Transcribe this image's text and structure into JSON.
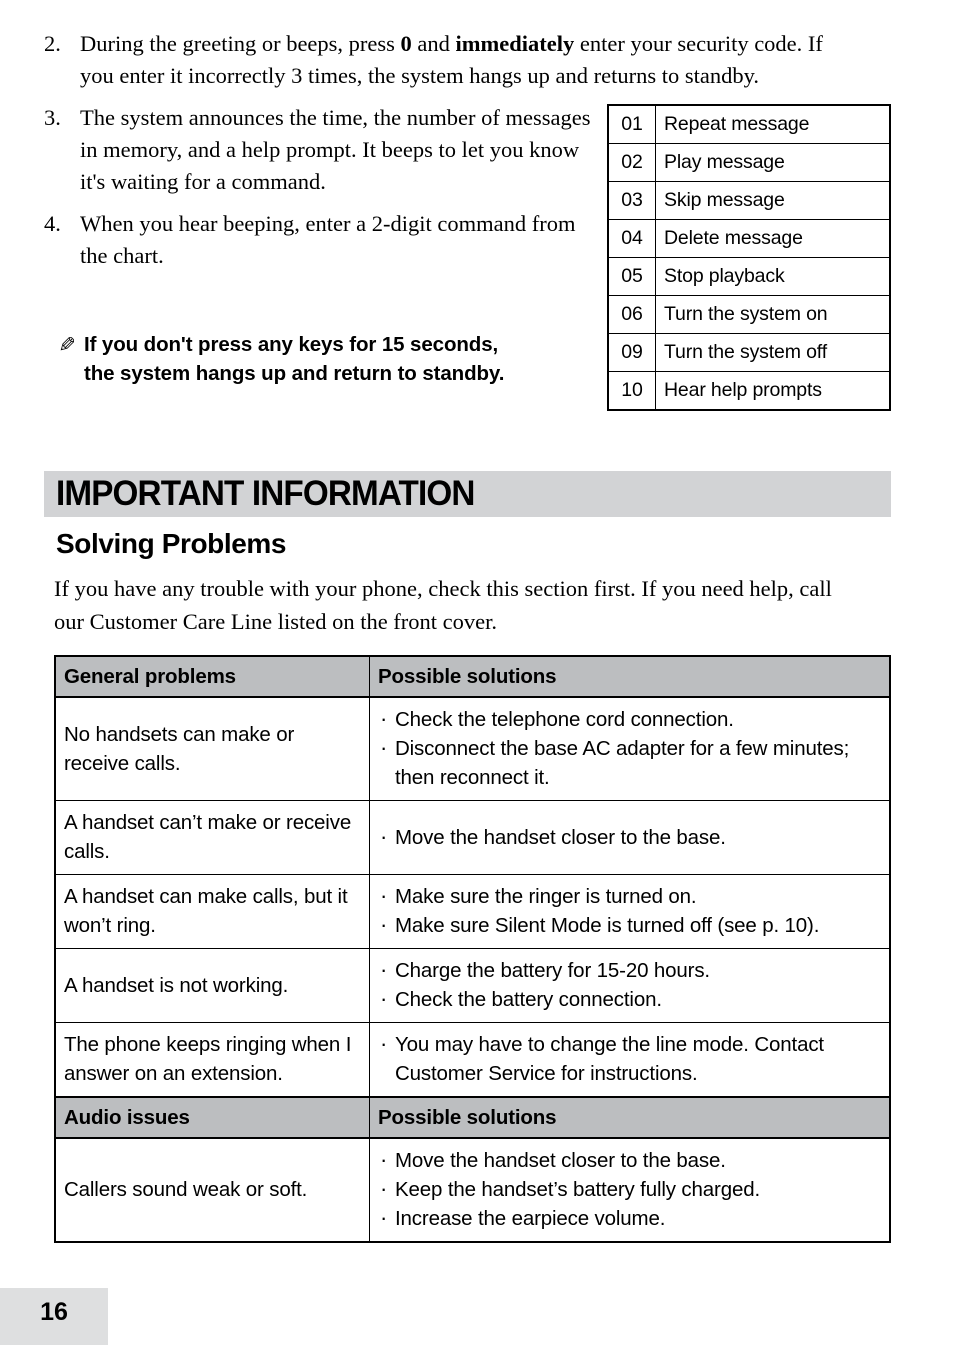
{
  "page": {
    "number": "16"
  },
  "steps": [
    {
      "num": "2.",
      "html": "During the greeting or beeps, press <b>0</b> and <b>immediately</b> enter your security code. If you enter it incorrectly 3 times, the system hangs up and returns to standby."
    },
    {
      "num": "3.",
      "html": "The system announces the time, the number of messages in memory, and a help prompt. It beeps to let you know it's waiting for a command."
    },
    {
      "num": "4.",
      "html": "When you hear beeping, enter a 2-digit command from the chart."
    }
  ],
  "note": {
    "icon": "pen-note-icon",
    "glyph": "✎",
    "text": "If you don't press any keys for 15 seconds, the system hangs up and return to standby."
  },
  "command_table": {
    "rows": [
      {
        "code": "01",
        "desc": "Repeat message"
      },
      {
        "code": "02",
        "desc": "Play message"
      },
      {
        "code": "03",
        "desc": "Skip message"
      },
      {
        "code": "04",
        "desc": "Delete message"
      },
      {
        "code": "05",
        "desc": "Stop playback"
      },
      {
        "code": "06",
        "desc": "Turn the system on"
      },
      {
        "code": "09",
        "desc": "Turn the system off"
      },
      {
        "code": "10",
        "desc": "Hear help prompts"
      }
    ]
  },
  "section": {
    "banner_title": "IMPORTANT INFORMATION",
    "banner_color": "#d2d3d5",
    "subtitle": "Solving Problems",
    "intro": "If you have any trouble with your phone, check this section first. If you need help, call our Customer Care Line listed on the front cover."
  },
  "problems_table": {
    "header_color": "#bcbec0",
    "general_header": {
      "problems": "General problems",
      "solutions": "Possible solutions"
    },
    "general_rows": [
      {
        "problem": "No handsets can make or receive calls.",
        "solutions": [
          "Check the telephone cord connection.",
          "Disconnect the base AC adapter for a few minutes; then reconnect it."
        ]
      },
      {
        "problem": "A handset can’t make or receive calls.",
        "solutions": [
          "Move the handset closer to the base."
        ]
      },
      {
        "problem": "A handset can make calls, but it won’t ring.",
        "solutions": [
          "Make sure the ringer is turned on.",
          "Make sure Silent Mode is turned off (see p. 10)."
        ]
      },
      {
        "problem": "A handset is not working.",
        "solutions": [
          "Charge the battery for 15-20 hours.",
          "Check the battery connection."
        ]
      },
      {
        "problem": "The phone keeps ringing when I answer on an extension.",
        "solutions": [
          "You may have to change the line mode. Contact Customer Service for instructions."
        ]
      }
    ],
    "audio_header": {
      "problems": "Audio issues",
      "solutions": "Possible solutions"
    },
    "audio_rows": [
      {
        "problem": "Callers sound weak or soft.",
        "solutions": [
          "Move the handset closer to the base.",
          "Keep the handset’s battery fully charged.",
          "Increase the earpiece volume."
        ]
      }
    ]
  }
}
